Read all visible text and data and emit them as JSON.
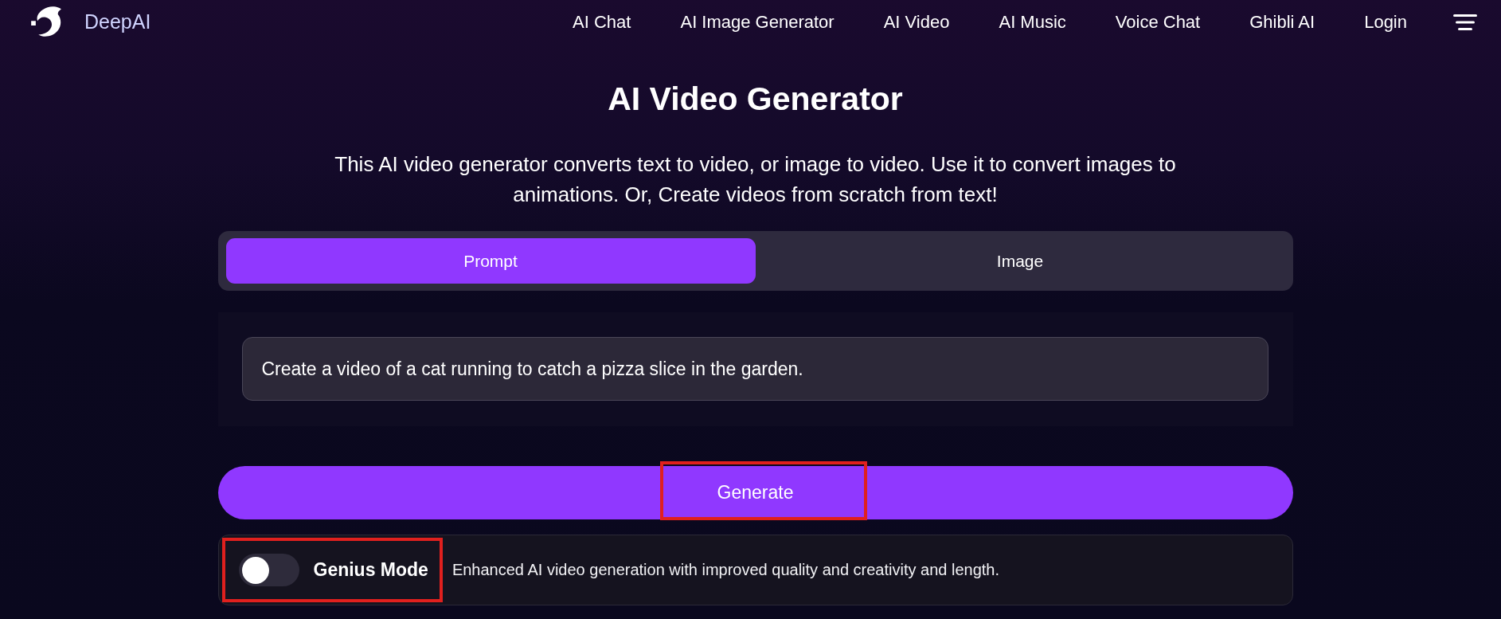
{
  "header": {
    "brand": "DeepAI",
    "nav": [
      {
        "label": "AI Chat"
      },
      {
        "label": "AI Image Generator"
      },
      {
        "label": "AI Video"
      },
      {
        "label": "AI Music"
      },
      {
        "label": "Voice Chat"
      },
      {
        "label": "Ghibli AI"
      },
      {
        "label": "Login"
      }
    ]
  },
  "title": "AI Video Generator",
  "description": "This AI video generator converts text to video, or image to video. Use it to convert images to animations. Or, Create videos from scratch from text!",
  "tabs": [
    {
      "label": "Prompt",
      "selected": true
    },
    {
      "label": "Image",
      "selected": false
    }
  ],
  "prompt_field": {
    "value": "Create a video of a cat running to catch a pizza slice in the garden."
  },
  "generate_button": {
    "label": "Generate",
    "highlighted": true
  },
  "genius_mode": {
    "on": false,
    "label": "Genius Mode",
    "description": "Enhanced AI video generation with improved quality and creativity and length.",
    "highlighted": true
  }
}
